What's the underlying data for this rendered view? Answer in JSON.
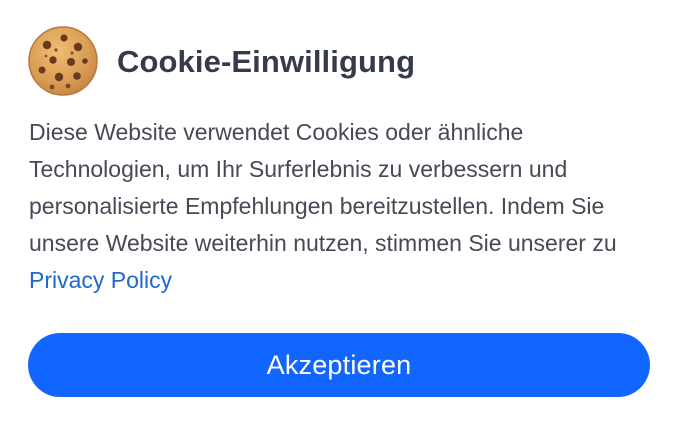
{
  "dialog": {
    "title": "Cookie-Einwilligung",
    "icon": "cookie-icon",
    "message_text": "Diese Website verwendet Cookies oder ähnliche Technologien, um Ihr Surferlebnis zu verbessern und personalisierte Empfehlungen bereitzustellen. Indem Sie unsere Website weiterhin nutzen, stimmen Sie unserer zu ",
    "privacy_link_label": "Privacy Policy",
    "accept_label": "Akzeptieren"
  },
  "colors": {
    "title": "#363b4a",
    "text": "#464a55",
    "link": "#1f67d2",
    "button": "#1166ff",
    "cookie_base": "#d9a05b",
    "cookie_chips": "#6a3a1e"
  }
}
